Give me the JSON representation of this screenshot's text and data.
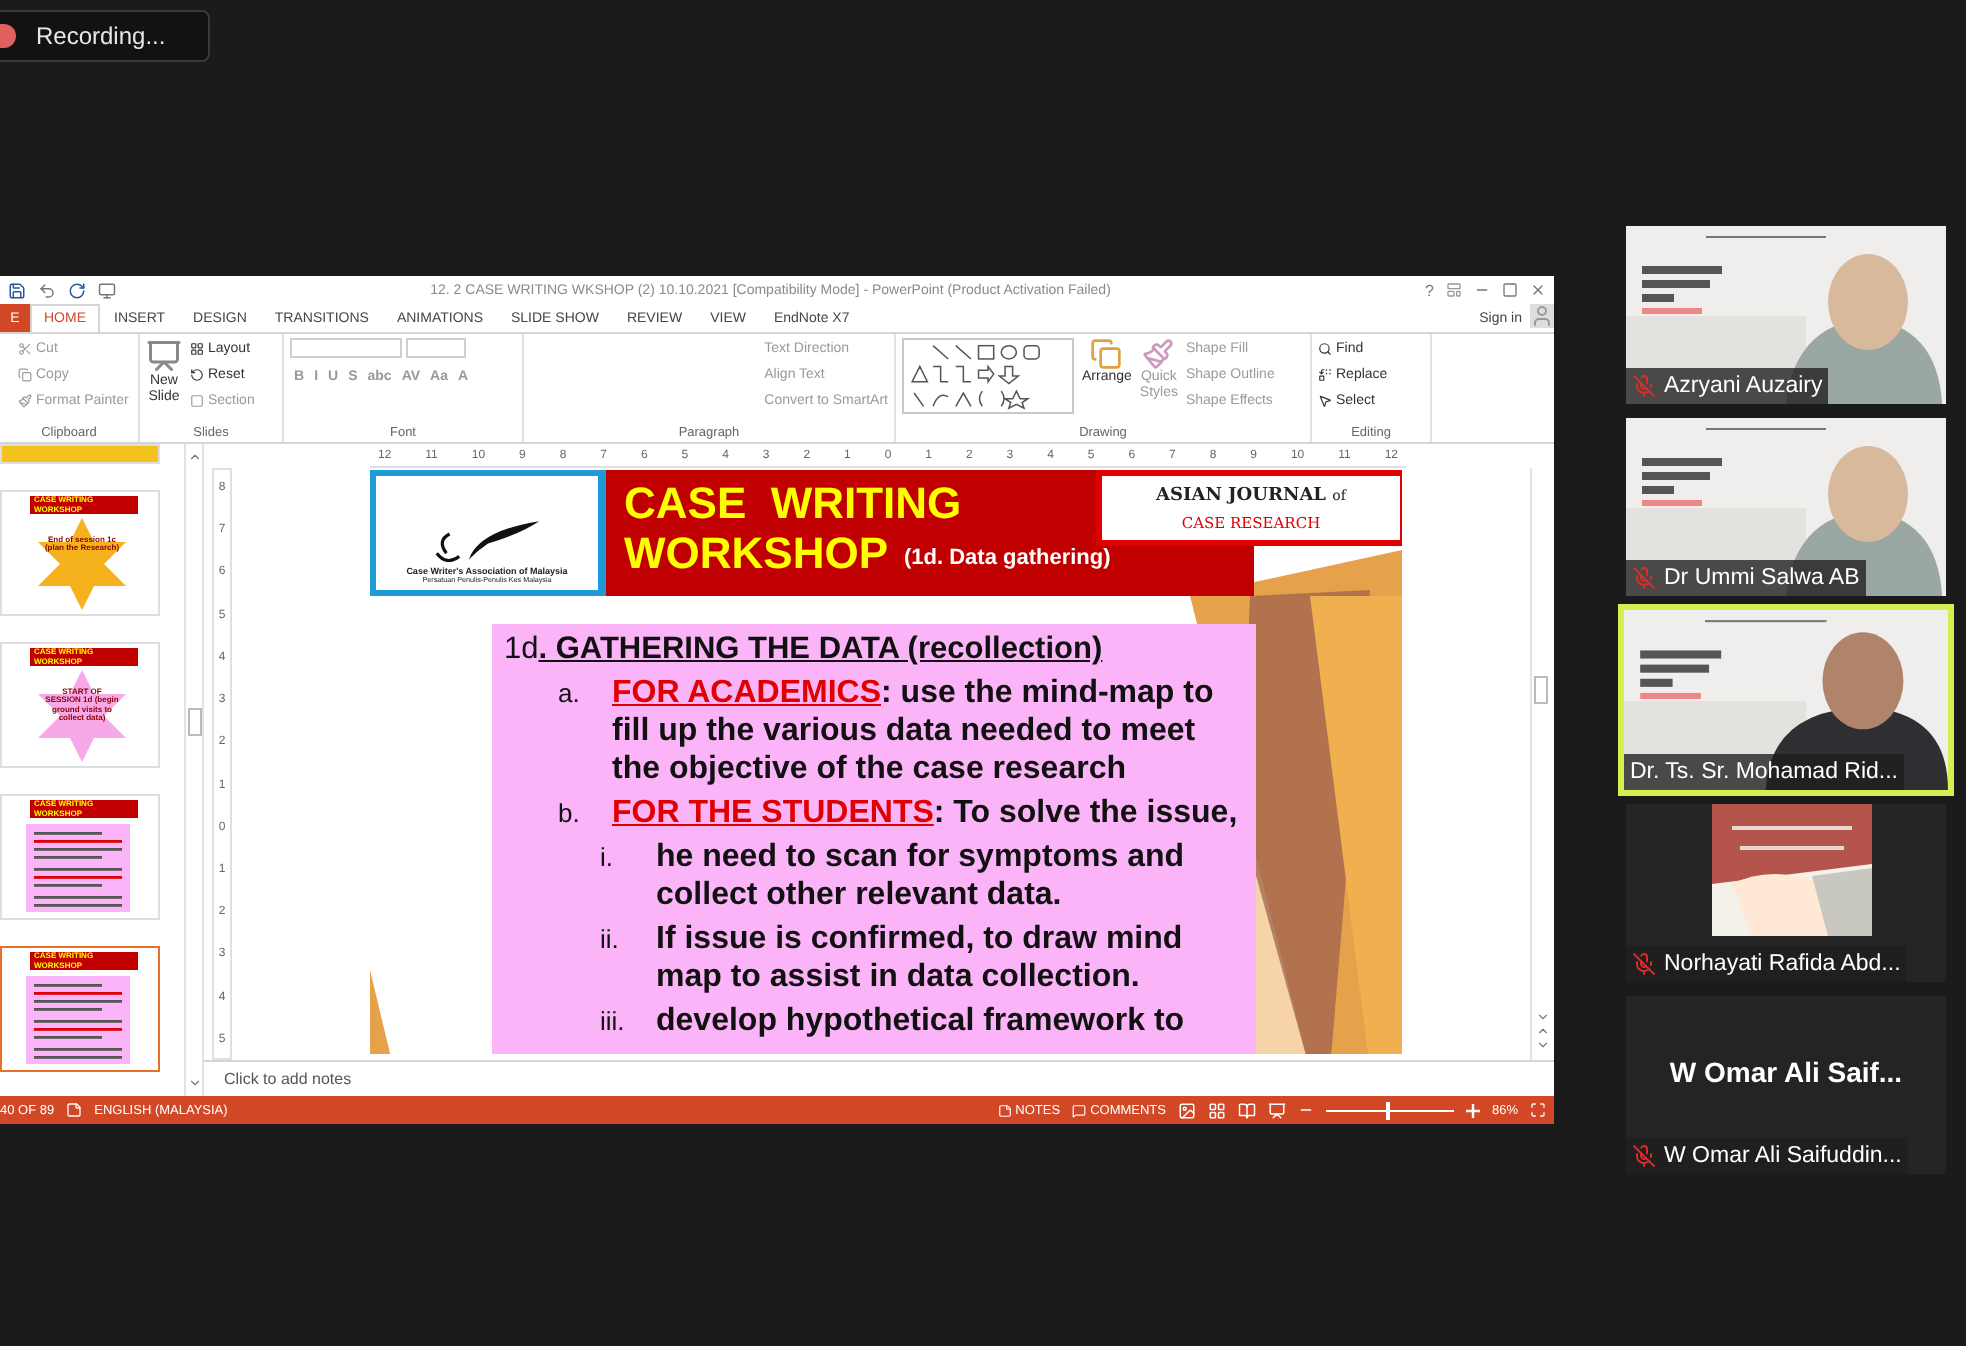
{
  "recording": {
    "label": "Recording..."
  },
  "window": {
    "title": "12. 2 CASE WRITING WKSHOP (2) 10.10.2021 [Compatibility Mode] - PowerPoint (Product Activation Failed)",
    "help": "?",
    "file_tab": "E",
    "sign_in": "Sign in",
    "tabs": [
      {
        "label": "HOME",
        "selected": true
      },
      {
        "label": "INSERT",
        "selected": false
      },
      {
        "label": "DESIGN",
        "selected": false
      },
      {
        "label": "TRANSITIONS",
        "selected": false
      },
      {
        "label": "ANIMATIONS",
        "selected": false
      },
      {
        "label": "SLIDE SHOW",
        "selected": false
      },
      {
        "label": "REVIEW",
        "selected": false
      },
      {
        "label": "VIEW",
        "selected": false
      },
      {
        "label": "EndNote X7",
        "selected": false
      }
    ]
  },
  "ribbon": {
    "clipboard": {
      "label": "Clipboard",
      "items": [
        {
          "label": "Cut",
          "disabled": true
        },
        {
          "label": "Copy",
          "disabled": true
        },
        {
          "label": "Format Painter",
          "disabled": true
        }
      ]
    },
    "slides": {
      "label": "Slides",
      "new_slide": [
        "New",
        "Slide"
      ],
      "items": [
        {
          "label": "Layout",
          "disabled": false
        },
        {
          "label": "Reset",
          "disabled": false
        },
        {
          "label": "Section",
          "disabled": true
        }
      ]
    },
    "font": {
      "label": "Font",
      "buttons": [
        "B",
        "I",
        "U",
        "S",
        "abc",
        "AV",
        "Aa",
        "A"
      ]
    },
    "paragraph": {
      "label": "Paragraph",
      "items": [
        {
          "label": "Text Direction",
          "disabled": true
        },
        {
          "label": "Align Text",
          "disabled": true
        },
        {
          "label": "Convert to SmartArt",
          "disabled": true
        }
      ]
    },
    "drawing": {
      "label": "Drawing",
      "arrange": "Arrange",
      "quick_styles": [
        "Quick",
        "Styles"
      ],
      "items": [
        {
          "label": "Shape Fill",
          "disabled": true
        },
        {
          "label": "Shape Outline",
          "disabled": true
        },
        {
          "label": "Shape Effects",
          "disabled": true
        }
      ]
    },
    "editing": {
      "label": "Editing",
      "items": [
        {
          "label": "Find",
          "disabled": false
        },
        {
          "label": "Replace",
          "disabled": false
        },
        {
          "label": "Select",
          "disabled": false
        }
      ]
    }
  },
  "ruler": {
    "horizontal": [
      "12",
      "11",
      "10",
      "9",
      "8",
      "7",
      "6",
      "5",
      "4",
      "3",
      "2",
      "1",
      "0",
      "1",
      "2",
      "3",
      "4",
      "5",
      "6",
      "7",
      "8",
      "9",
      "10",
      "11",
      "12"
    ],
    "vertical": [
      "8",
      "7",
      "6",
      "5",
      "4",
      "3",
      "2",
      "1",
      "0",
      "1",
      "2",
      "3",
      "4",
      "5"
    ]
  },
  "thumbnails": [
    {
      "kind": "partial",
      "selected": false
    },
    {
      "kind": "star",
      "title": "CASE WRITING WORKSHOP",
      "star_text": "End of session 1c (plan the Research)",
      "color": "#f5b21d",
      "selected": false
    },
    {
      "kind": "star",
      "title": "CASE WRITING WORKSHOP",
      "star_text": "START OF SESSION 1d (begin ground visits to collect data)",
      "color": "#f7a8e8",
      "selected": false
    },
    {
      "kind": "text",
      "title": "CASE WRITING WORKSHOP",
      "selected": false
    },
    {
      "kind": "text",
      "title": "CASE WRITING WORKSHOP",
      "selected": true
    }
  ],
  "slide": {
    "association": "Case Writer's Association of Malaysia",
    "association_local": "Persatuan Penulis-Penulis Kes Malaysia",
    "title_lines": [
      "CASE  WRITING",
      "WORKSHOP"
    ],
    "subtitle": "(1d. Data gathering)",
    "journal": {
      "name": "ASIAN JOURNAL",
      "of": "of",
      "line2": "CASE RESEARCH"
    },
    "heading": {
      "prefix": "1d",
      "text": ". GATHERING THE DATA (recollection)"
    },
    "items": [
      {
        "marker": "a.",
        "lead": "FOR ACADEMICS",
        "text": ": use the mind-map to fill up the various data needed to meet the objective of the case research"
      },
      {
        "marker": "b.",
        "lead": "FOR THE STUDENTS",
        "text": ": To solve the issue,",
        "sub": [
          {
            "marker": "i.",
            "text": "he need to scan for symptoms and collect other relevant data."
          },
          {
            "marker": "ii.",
            "text": "If issue is confirmed, to draw mind map to assist in data collection."
          },
          {
            "marker": "iii.",
            "text": "develop hypothetical framework to"
          }
        ]
      }
    ]
  },
  "notes": {
    "placeholder": "Click to add notes"
  },
  "status_bar": {
    "slide": "40 OF 89",
    "language": "ENGLISH (MALAYSIA)",
    "notes": "NOTES",
    "comments": "COMMENTS",
    "zoom": {
      "label": "86%",
      "level": 0.47
    }
  },
  "participants": [
    {
      "kind": "video",
      "name": "Azryani Auzairy",
      "muted": true,
      "speaking": false
    },
    {
      "kind": "video",
      "name": "Dr Ummi Salwa AB",
      "muted": true,
      "speaking": false
    },
    {
      "kind": "video",
      "name": "Dr. Ts. Sr. Mohamad Rid...",
      "muted": false,
      "speaking": true
    },
    {
      "kind": "avatar",
      "name": "Norhayati Rafida Abd...",
      "muted": true,
      "speaking": false
    },
    {
      "kind": "name",
      "display": "W Omar Ali Saif...",
      "name": "W Omar Ali Saifuddin...",
      "muted": true,
      "speaking": false
    }
  ]
}
